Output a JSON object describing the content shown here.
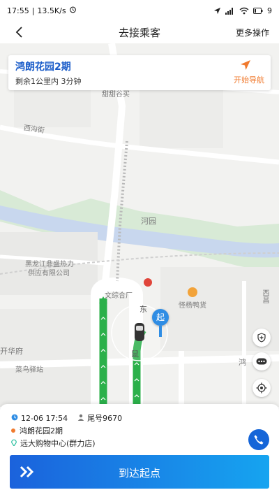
{
  "status_bar": {
    "time": "17:55",
    "net_speed": "13.5K/s",
    "battery": "9"
  },
  "header": {
    "title": "去接乘客",
    "more_label": "更多操作"
  },
  "destination": {
    "name": "鸿朗花园2期",
    "remaining": "剩余1公里内 3分钟",
    "nav_label": "开始导航"
  },
  "map": {
    "labels": {
      "street_1": "西沟街",
      "street_2": "甜甜谷买",
      "river": "河园",
      "company": "黑龙江鼎盛热力",
      "company_2": "供应有限公司",
      "restaurant": "怪杨鸭货",
      "complex": "文综合厂",
      "east": "东",
      "side": "鼠",
      "district": "开华府",
      "station": "菜鸟驿站",
      "hong": "鸿",
      "xiche": "西昌",
      "start_badge": "起"
    },
    "route_color": "#2bb04a",
    "start_color": "#2f8de4"
  },
  "order": {
    "datetime": "12-06 17:54",
    "tail_number": "尾号9670",
    "pickup": "鸿朗花园2期",
    "dropoff": "远大购物中心(群力店)",
    "pickup_color": "#f07a2e",
    "dropoff_color": "#2cc0a0"
  },
  "action": {
    "arrive_label": "到达起点"
  }
}
